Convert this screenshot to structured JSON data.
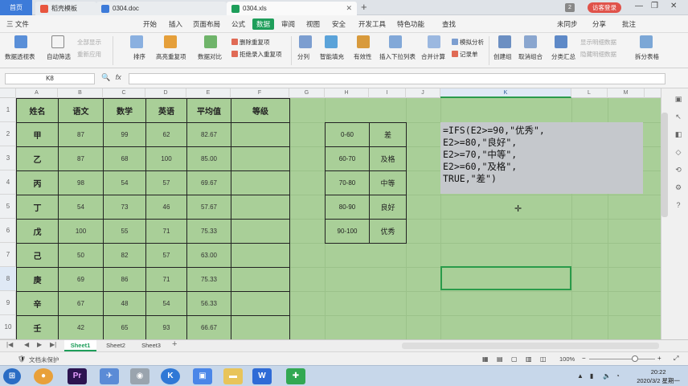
{
  "window": {
    "tabs": [
      {
        "label": "首页"
      },
      {
        "label": "稻壳模板"
      },
      {
        "label": "0304.doc"
      },
      {
        "label": "0304.xls"
      }
    ],
    "notification_count": "2",
    "visitor_label": "访客登录"
  },
  "menu": {
    "file": "三 文件",
    "items": [
      "开始",
      "插入",
      "页面布局",
      "公式",
      "数据",
      "审阅",
      "视图",
      "安全",
      "开发工具",
      "特色功能",
      "查找"
    ],
    "active": "数据",
    "right": [
      "未同步",
      "分享",
      "批注"
    ]
  },
  "ribbon": {
    "pivot": "数据透视表",
    "autofilter": "自动筛选",
    "show_all": "全部显示",
    "reapply": "重新应用",
    "sort": "排序",
    "highlight_dup": "高亮重复项",
    "compare": "数据对比",
    "remove_dup": "删除重复项",
    "reject_dup": "拒绝录入重复项",
    "split": "分列",
    "smart_fill": "智能填充",
    "validity": "有效性",
    "dropdown": "插入下拉列表",
    "consolidate": "合并计算",
    "whatif": "模拟分析",
    "record": "记录单",
    "group": "创建组",
    "ungroup": "取消组合",
    "subtotal": "分类汇总",
    "show_detail": "显示明细数据",
    "hide_detail": "隐藏明细数据",
    "split_table": "拆分表格"
  },
  "formula_bar": {
    "name_box": "K8",
    "fx": "fx",
    "value": ""
  },
  "columns": [
    "A",
    "B",
    "C",
    "D",
    "E",
    "F",
    "G",
    "H",
    "I",
    "J",
    "K",
    "L",
    "M"
  ],
  "rows": [
    "1",
    "2",
    "3",
    "4",
    "5",
    "6",
    "7",
    "8",
    "9",
    "10"
  ],
  "score_table": {
    "headers": [
      "姓名",
      "语文",
      "数学",
      "英语",
      "平均值",
      "等级"
    ],
    "rows": [
      [
        "甲",
        "87",
        "99",
        "62",
        "82.67",
        ""
      ],
      [
        "乙",
        "87",
        "68",
        "100",
        "85.00",
        ""
      ],
      [
        "丙",
        "98",
        "54",
        "57",
        "69.67",
        ""
      ],
      [
        "丁",
        "54",
        "73",
        "46",
        "57.67",
        ""
      ],
      [
        "戊",
        "100",
        "55",
        "71",
        "75.33",
        ""
      ],
      [
        "己",
        "50",
        "82",
        "57",
        "63.00",
        ""
      ],
      [
        "庚",
        "69",
        "86",
        "71",
        "75.33",
        ""
      ],
      [
        "辛",
        "67",
        "48",
        "54",
        "56.33",
        ""
      ],
      [
        "壬",
        "42",
        "65",
        "93",
        "66.67",
        ""
      ]
    ]
  },
  "grade_table": [
    [
      "0-60",
      "差"
    ],
    [
      "60-70",
      "及格"
    ],
    [
      "70-80",
      "中等"
    ],
    [
      "80-90",
      "良好"
    ],
    [
      "90-100",
      "优秀"
    ]
  ],
  "formula_note": [
    "=IFS(E2>=90,\"优秀\",",
    "E2>=80,\"良好\",",
    "E2>=70,\"中等\",",
    "E2>=60,\"及格\",",
    "TRUE,\"差\")"
  ],
  "sheets": [
    "Sheet1",
    "Sheet2",
    "Sheet3"
  ],
  "active_sheet": "Sheet1",
  "status": {
    "protect": "文档未保护",
    "zoom": "100%"
  },
  "taskbar": {
    "time": "20:22",
    "date": "2020/3/2 星期一"
  },
  "colors": {
    "accent": "#1e9e5a",
    "sheet_bg": "#a9cf98",
    "formula_bg": "#c5c8cc",
    "home_tab": "#3d7bd9",
    "visitor": "#e0524a"
  }
}
